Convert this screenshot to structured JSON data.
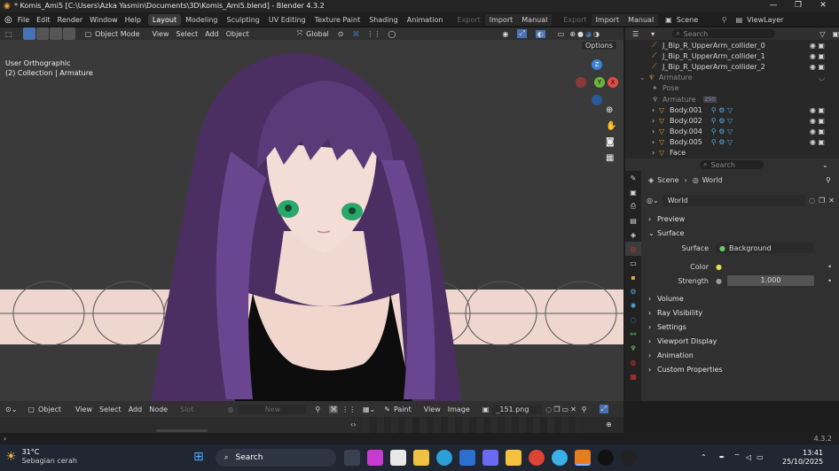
{
  "titlebar": {
    "title": "* Komis_Ami5 [C:\\Users\\Azka Yasmin\\Documents\\3D\\Komis_Ami5.blend] - Blender 4.3.2",
    "minimize": "—",
    "maximize": "❐",
    "close": "✕"
  },
  "menubar": {
    "menus": [
      "File",
      "Edit",
      "Render",
      "Window",
      "Help"
    ],
    "workspaces": [
      "Layout",
      "Modeling",
      "Sculpting",
      "UV Editing",
      "Texture Paint",
      "Shading",
      "Animation"
    ],
    "active_workspace": "Layout",
    "export1": "Export",
    "import1": "Import",
    "manual1": "Manual",
    "export2": "Export",
    "import2": "Import",
    "manual2": "Manual",
    "scene_label": "Scene",
    "viewlayer_label": "ViewLayer"
  },
  "viewport": {
    "mode": "Object Mode",
    "menus": [
      "View",
      "Select",
      "Add",
      "Object"
    ],
    "orientation": "Global",
    "options": "Options",
    "overlay_line1": "User Orthographic",
    "overlay_line2": "(2) Collection | Armature",
    "gizmo": {
      "z": "Z",
      "y": "Y",
      "x": "X"
    }
  },
  "outliner": {
    "search_placeholder": "Search",
    "rows": [
      {
        "label": "J_Bip_R_UpperArm_collider_0",
        "kind": "bone"
      },
      {
        "label": "J_Bip_R_UpperArm_collider_1",
        "kind": "bone"
      },
      {
        "label": "J_Bip_R_UpperArm_collider_2",
        "kind": "bone"
      },
      {
        "label": "Armature",
        "kind": "armature"
      },
      {
        "label": "Pose",
        "kind": "pose"
      },
      {
        "label": "Armature",
        "kind": "armature-data"
      },
      {
        "label": "Body.001",
        "kind": "mesh"
      },
      {
        "label": "Body.002",
        "kind": "mesh"
      },
      {
        "label": "Body.004",
        "kind": "mesh"
      },
      {
        "label": "Body.005",
        "kind": "mesh"
      },
      {
        "label": "Face",
        "kind": "mesh"
      }
    ],
    "badge_250": "250"
  },
  "properties": {
    "search_placeholder": "Search",
    "breadcrumb_scene": "Scene",
    "breadcrumb_world": "World",
    "world_name": "World",
    "sections": {
      "preview": "Preview",
      "surface": "Surface",
      "volume": "Volume",
      "ray_visibility": "Ray Visibility",
      "settings": "Settings",
      "viewport_display": "Viewport Display",
      "animation": "Animation",
      "custom_properties": "Custom Properties"
    },
    "surface_label": "Surface",
    "surface_value": "Background",
    "color_label": "Color",
    "strength_label": "Strength",
    "strength_value": "1.000"
  },
  "node_editor": {
    "mode": "Object",
    "menus": [
      "View",
      "Select",
      "Add",
      "Node"
    ],
    "slot": "Slot",
    "new": "New"
  },
  "image_editor": {
    "mode": "Paint",
    "menus": [
      "View",
      "Image"
    ],
    "image_name": "_151.png"
  },
  "status": {
    "version": "4.3.2"
  },
  "taskbar": {
    "temp": "31°C",
    "weather": "Sebagian cerah",
    "search": "Search",
    "time": "13:41",
    "date": "25/10/2025"
  },
  "colors": {
    "accent_blue": "#4772b3",
    "hair": "#5a3a78",
    "skin": "#f0d6cf",
    "axis_x": "#e34a4a",
    "axis_y": "#6ab43c",
    "axis_z": "#3b82d9"
  }
}
